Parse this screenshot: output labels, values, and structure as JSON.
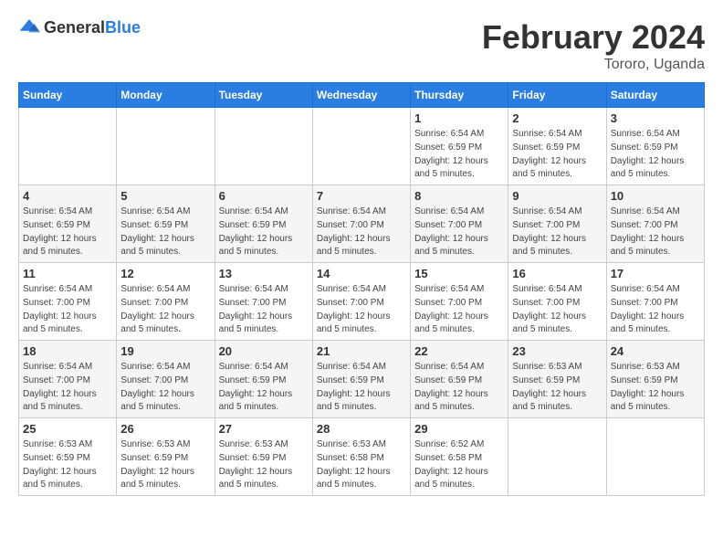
{
  "logo": {
    "general": "General",
    "blue": "Blue"
  },
  "header": {
    "title": "February 2024",
    "subtitle": "Tororo, Uganda"
  },
  "weekdays": [
    "Sunday",
    "Monday",
    "Tuesday",
    "Wednesday",
    "Thursday",
    "Friday",
    "Saturday"
  ],
  "weeks": [
    [
      {
        "day": "",
        "sunrise": "",
        "sunset": "",
        "daylight": ""
      },
      {
        "day": "",
        "sunrise": "",
        "sunset": "",
        "daylight": ""
      },
      {
        "day": "",
        "sunrise": "",
        "sunset": "",
        "daylight": ""
      },
      {
        "day": "",
        "sunrise": "",
        "sunset": "",
        "daylight": ""
      },
      {
        "day": "1",
        "sunrise": "Sunrise: 6:54 AM",
        "sunset": "Sunset: 6:59 PM",
        "daylight": "Daylight: 12 hours and 5 minutes."
      },
      {
        "day": "2",
        "sunrise": "Sunrise: 6:54 AM",
        "sunset": "Sunset: 6:59 PM",
        "daylight": "Daylight: 12 hours and 5 minutes."
      },
      {
        "day": "3",
        "sunrise": "Sunrise: 6:54 AM",
        "sunset": "Sunset: 6:59 PM",
        "daylight": "Daylight: 12 hours and 5 minutes."
      }
    ],
    [
      {
        "day": "4",
        "sunrise": "Sunrise: 6:54 AM",
        "sunset": "Sunset: 6:59 PM",
        "daylight": "Daylight: 12 hours and 5 minutes."
      },
      {
        "day": "5",
        "sunrise": "Sunrise: 6:54 AM",
        "sunset": "Sunset: 6:59 PM",
        "daylight": "Daylight: 12 hours and 5 minutes."
      },
      {
        "day": "6",
        "sunrise": "Sunrise: 6:54 AM",
        "sunset": "Sunset: 6:59 PM",
        "daylight": "Daylight: 12 hours and 5 minutes."
      },
      {
        "day": "7",
        "sunrise": "Sunrise: 6:54 AM",
        "sunset": "Sunset: 7:00 PM",
        "daylight": "Daylight: 12 hours and 5 minutes."
      },
      {
        "day": "8",
        "sunrise": "Sunrise: 6:54 AM",
        "sunset": "Sunset: 7:00 PM",
        "daylight": "Daylight: 12 hours and 5 minutes."
      },
      {
        "day": "9",
        "sunrise": "Sunrise: 6:54 AM",
        "sunset": "Sunset: 7:00 PM",
        "daylight": "Daylight: 12 hours and 5 minutes."
      },
      {
        "day": "10",
        "sunrise": "Sunrise: 6:54 AM",
        "sunset": "Sunset: 7:00 PM",
        "daylight": "Daylight: 12 hours and 5 minutes."
      }
    ],
    [
      {
        "day": "11",
        "sunrise": "Sunrise: 6:54 AM",
        "sunset": "Sunset: 7:00 PM",
        "daylight": "Daylight: 12 hours and 5 minutes."
      },
      {
        "day": "12",
        "sunrise": "Sunrise: 6:54 AM",
        "sunset": "Sunset: 7:00 PM",
        "daylight": "Daylight: 12 hours and 5 minutes."
      },
      {
        "day": "13",
        "sunrise": "Sunrise: 6:54 AM",
        "sunset": "Sunset: 7:00 PM",
        "daylight": "Daylight: 12 hours and 5 minutes."
      },
      {
        "day": "14",
        "sunrise": "Sunrise: 6:54 AM",
        "sunset": "Sunset: 7:00 PM",
        "daylight": "Daylight: 12 hours and 5 minutes."
      },
      {
        "day": "15",
        "sunrise": "Sunrise: 6:54 AM",
        "sunset": "Sunset: 7:00 PM",
        "daylight": "Daylight: 12 hours and 5 minutes."
      },
      {
        "day": "16",
        "sunrise": "Sunrise: 6:54 AM",
        "sunset": "Sunset: 7:00 PM",
        "daylight": "Daylight: 12 hours and 5 minutes."
      },
      {
        "day": "17",
        "sunrise": "Sunrise: 6:54 AM",
        "sunset": "Sunset: 7:00 PM",
        "daylight": "Daylight: 12 hours and 5 minutes."
      }
    ],
    [
      {
        "day": "18",
        "sunrise": "Sunrise: 6:54 AM",
        "sunset": "Sunset: 7:00 PM",
        "daylight": "Daylight: 12 hours and 5 minutes."
      },
      {
        "day": "19",
        "sunrise": "Sunrise: 6:54 AM",
        "sunset": "Sunset: 7:00 PM",
        "daylight": "Daylight: 12 hours and 5 minutes."
      },
      {
        "day": "20",
        "sunrise": "Sunrise: 6:54 AM",
        "sunset": "Sunset: 6:59 PM",
        "daylight": "Daylight: 12 hours and 5 minutes."
      },
      {
        "day": "21",
        "sunrise": "Sunrise: 6:54 AM",
        "sunset": "Sunset: 6:59 PM",
        "daylight": "Daylight: 12 hours and 5 minutes."
      },
      {
        "day": "22",
        "sunrise": "Sunrise: 6:54 AM",
        "sunset": "Sunset: 6:59 PM",
        "daylight": "Daylight: 12 hours and 5 minutes."
      },
      {
        "day": "23",
        "sunrise": "Sunrise: 6:53 AM",
        "sunset": "Sunset: 6:59 PM",
        "daylight": "Daylight: 12 hours and 5 minutes."
      },
      {
        "day": "24",
        "sunrise": "Sunrise: 6:53 AM",
        "sunset": "Sunset: 6:59 PM",
        "daylight": "Daylight: 12 hours and 5 minutes."
      }
    ],
    [
      {
        "day": "25",
        "sunrise": "Sunrise: 6:53 AM",
        "sunset": "Sunset: 6:59 PM",
        "daylight": "Daylight: 12 hours and 5 minutes."
      },
      {
        "day": "26",
        "sunrise": "Sunrise: 6:53 AM",
        "sunset": "Sunset: 6:59 PM",
        "daylight": "Daylight: 12 hours and 5 minutes."
      },
      {
        "day": "27",
        "sunrise": "Sunrise: 6:53 AM",
        "sunset": "Sunset: 6:59 PM",
        "daylight": "Daylight: 12 hours and 5 minutes."
      },
      {
        "day": "28",
        "sunrise": "Sunrise: 6:53 AM",
        "sunset": "Sunset: 6:58 PM",
        "daylight": "Daylight: 12 hours and 5 minutes."
      },
      {
        "day": "29",
        "sunrise": "Sunrise: 6:52 AM",
        "sunset": "Sunset: 6:58 PM",
        "daylight": "Daylight: 12 hours and 5 minutes."
      },
      {
        "day": "",
        "sunrise": "",
        "sunset": "",
        "daylight": ""
      },
      {
        "day": "",
        "sunrise": "",
        "sunset": "",
        "daylight": ""
      }
    ]
  ]
}
